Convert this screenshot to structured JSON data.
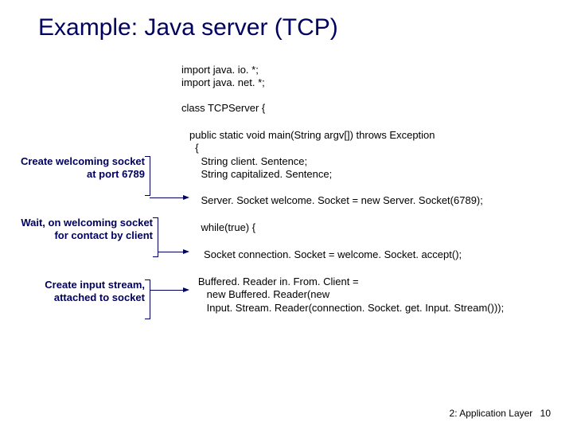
{
  "title": "Example: Java server (TCP)",
  "code": {
    "imports": "import java. io. *;\nimport java. net. *;",
    "classdecl": "class TCPServer {",
    "mainsig": "public static void main(String argv[]) throws Exception\n  {",
    "strings": "    String client. Sentence;\n    String capitalized. Sentence;",
    "welcome": "    Server. Socket welcome. Socket = new Server. Socket(6789);",
    "whileloop": "    while(true) {",
    "accept": "     Socket connection. Socket = welcome. Socket. accept();",
    "buffered": "   Buffered. Reader in. From. Client =\n      new Buffered. Reader(new\n      Input. Stream. Reader(connection. Socket. get. Input. Stream()));"
  },
  "annotations": {
    "a1": "Create\nwelcoming socket\nat port 6789",
    "a2": "Wait, on welcoming\nsocket for contact\nby client",
    "a3": "Create input\nstream, attached\nto socket"
  },
  "footer": {
    "chapter": "2: Application Layer",
    "page": "10"
  }
}
